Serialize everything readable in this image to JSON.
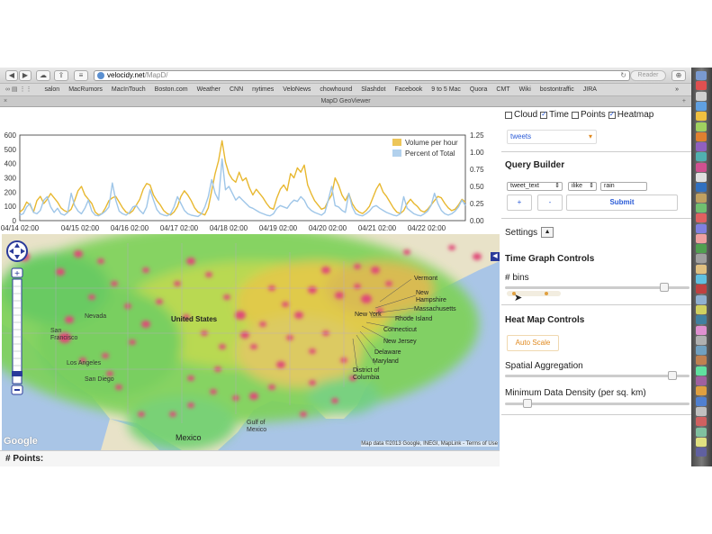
{
  "browser": {
    "url_domain": "velocidy.net",
    "url_path": "/MapD/",
    "reader_label": "Reader",
    "window_title": "MapD GeoViewer",
    "bookmarks": [
      "salon",
      "MacRumors",
      "MacInTouch",
      "Boston.com",
      "Weather",
      "CNN",
      "nytimes",
      "VeloNews",
      "chowhound",
      "Slashdot",
      "Facebook",
      "9 to 5 Mac",
      "Quora",
      "CMT",
      "Wiki",
      "bostontraffic",
      "JIRA"
    ]
  },
  "controls": {
    "layers": [
      {
        "label": "Cloud",
        "checked": false
      },
      {
        "label": "Time",
        "checked": true
      },
      {
        "label": "Points",
        "checked": false
      },
      {
        "label": "Heatmap",
        "checked": true
      }
    ],
    "table_select": "tweets",
    "query_builder_title": "Query Builder",
    "field_select": "tweet_text",
    "operator_select": "ilike",
    "value_input": "rain",
    "add_label": "+",
    "remove_label": "-",
    "submit_label": "Submit",
    "settings_label": "Settings",
    "settings_toggle": "▲",
    "time_graph_title": "Time Graph Controls",
    "bins_label": "# bins",
    "heatmap_title": "Heat Map Controls",
    "autoscale_label": "Auto Scale",
    "spatial_label": "Spatial Aggregation",
    "density_label": "Minimum Data Density (per sq. km)",
    "bins_value": 0.88,
    "spatial_value": 0.93,
    "density_value": 0.1
  },
  "map": {
    "labels": {
      "united_states": "United States",
      "nevada": "Nevada",
      "san_francisco": "San Francisco",
      "los_angeles": "Los Angeles",
      "san_diego": "San Diego",
      "mexico": "Mexico",
      "gulf": "Gulf of Mexico",
      "new_york": "New York",
      "new_hampshire": "New Hampshire",
      "massachusetts": "Massachusetts",
      "rhode_island": "Rhode Island",
      "connecticut": "Connecticut",
      "new_jersey": "New Jersey",
      "delaware": "Delaware",
      "maryland": "Maryland",
      "dc": "District of Columbia",
      "vermont": "Vermont"
    },
    "attribution": "Map data ©2013 Google, INEGI, MapLink - Terms of Use",
    "google_logo": "Google"
  },
  "points_label": "# Points:",
  "chart_data": {
    "type": "line",
    "x_ticks": [
      "04/14 02:00",
      "04/15 02:00",
      "04/16 02:00",
      "04/17 02:00",
      "04/18 02:00",
      "04/19 02:00",
      "04/20 02:00",
      "04/21 02:00",
      "04/22 02:00"
    ],
    "y_left_ticks": [
      "0",
      "100",
      "200",
      "300",
      "400",
      "500",
      "600"
    ],
    "y_right_ticks": [
      "0.00",
      "0.25",
      "0.50",
      "0.75",
      "1.00",
      "1.25"
    ],
    "ylim_left": [
      0,
      600
    ],
    "ylim_right": [
      0,
      1.25
    ],
    "legend_position": "top-right",
    "series": [
      {
        "name": "Volume per hour",
        "axis": "left",
        "color": "#e8b830",
        "values": [
          60,
          80,
          130,
          110,
          60,
          140,
          170,
          120,
          150,
          190,
          160,
          130,
          90,
          70,
          60,
          80,
          140,
          210,
          240,
          180,
          150,
          120,
          60,
          40,
          50,
          90,
          140,
          160,
          170,
          130,
          90,
          60,
          50,
          70,
          110,
          150,
          220,
          260,
          250,
          180,
          140,
          110,
          70,
          50,
          40,
          60,
          100,
          170,
          210,
          180,
          140,
          90,
          60,
          50,
          40,
          90,
          210,
          330,
          420,
          560,
          410,
          330,
          290,
          270,
          340,
          280,
          300,
          230,
          180,
          220,
          190,
          160,
          120,
          90,
          80,
          160,
          220,
          250,
          210,
          330,
          300,
          370,
          340,
          390,
          250,
          190,
          140,
          110,
          80,
          90,
          140,
          180,
          300,
          250,
          180,
          140,
          190,
          120,
          80,
          60,
          50,
          70,
          100,
          160,
          220,
          260,
          200,
          170,
          130,
          90,
          60,
          50,
          70,
          120,
          150,
          120,
          100,
          70,
          60,
          80,
          110,
          140,
          170,
          160,
          120,
          90,
          70,
          80,
          110,
          150,
          130
        ]
      },
      {
        "name": "Percent of Total",
        "axis": "right",
        "color": "#9fc6e8",
        "values": [
          0.08,
          0.1,
          0.2,
          0.25,
          0.12,
          0.1,
          0.15,
          0.3,
          0.35,
          0.2,
          0.12,
          0.18,
          0.1,
          0.08,
          0.12,
          0.4,
          0.22,
          0.14,
          0.1,
          0.18,
          0.3,
          0.14,
          0.08,
          0.07,
          0.1,
          0.14,
          0.2,
          0.55,
          0.3,
          0.14,
          0.1,
          0.08,
          0.12,
          0.2,
          0.22,
          0.15,
          0.1,
          0.2,
          0.45,
          0.3,
          0.16,
          0.1,
          0.08,
          0.07,
          0.1,
          0.2,
          0.35,
          0.25,
          0.15,
          0.1,
          0.08,
          0.07,
          0.06,
          0.1,
          0.2,
          0.35,
          0.6,
          0.4,
          0.3,
          0.9,
          0.45,
          0.5,
          0.4,
          0.3,
          0.35,
          0.3,
          0.25,
          0.2,
          0.18,
          0.15,
          0.12,
          0.1,
          0.08,
          0.07,
          0.1,
          0.18,
          0.22,
          0.2,
          0.18,
          0.25,
          0.3,
          0.28,
          0.35,
          0.3,
          0.2,
          0.15,
          0.12,
          0.1,
          0.08,
          0.12,
          0.3,
          0.5,
          0.22,
          0.2,
          0.15,
          0.12,
          0.4,
          0.2,
          0.1,
          0.08,
          0.07,
          0.1,
          0.14,
          0.2,
          0.22,
          0.18,
          0.15,
          0.12,
          0.1,
          0.08,
          0.07,
          0.1,
          0.35,
          0.18,
          0.14,
          0.1,
          0.08,
          0.07,
          0.1,
          0.14,
          0.22,
          0.4,
          0.25,
          0.15,
          0.1,
          0.08,
          0.1,
          0.14,
          0.2,
          0.3,
          0.22
        ]
      }
    ]
  }
}
